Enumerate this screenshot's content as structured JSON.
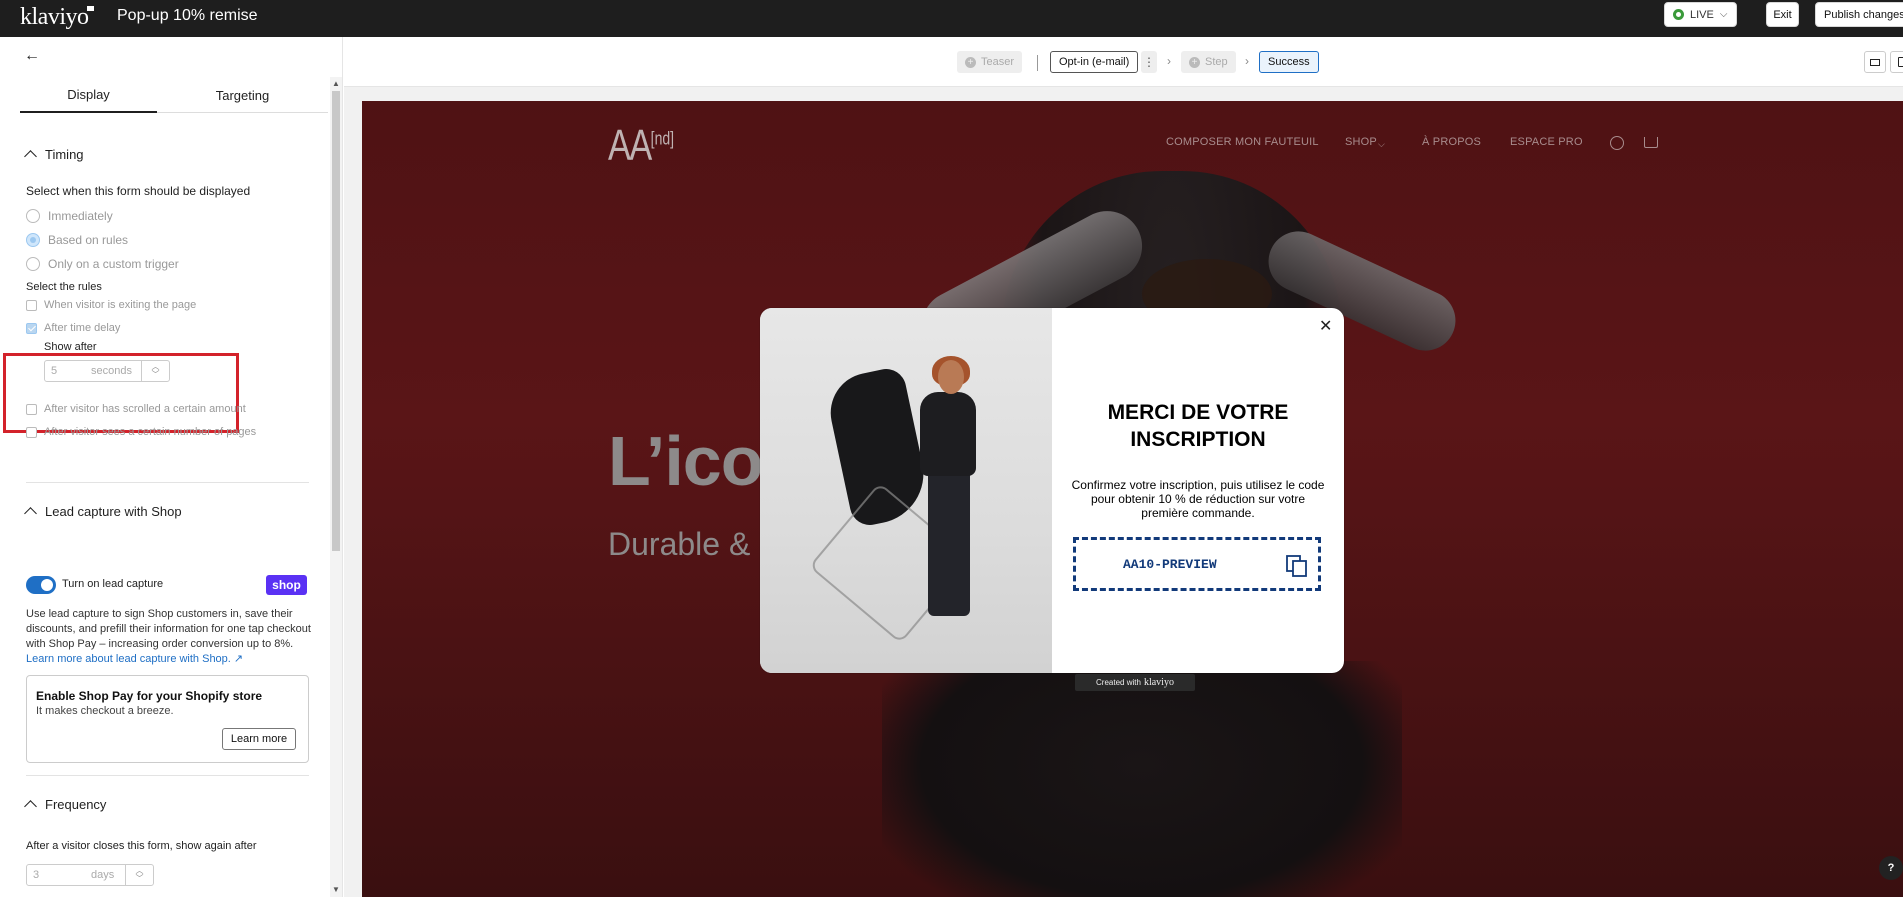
{
  "topbar": {
    "logo": "klaviyo",
    "form_title": "Pop-up 10% remise",
    "status_label": "LIVE",
    "exit_label": "Exit",
    "publish_label": "Publish changes"
  },
  "tabs": [
    {
      "label": "Display",
      "active": true
    },
    {
      "label": "Targeting",
      "active": false
    }
  ],
  "timing": {
    "heading": "Timing",
    "prompt": "Select when this form should be displayed",
    "options": [
      {
        "label": "Immediately",
        "selected": false
      },
      {
        "label": "Based on rules",
        "selected": true
      },
      {
        "label": "Only on a custom trigger",
        "selected": false
      }
    ],
    "rules_label": "Select the rules",
    "rules": [
      {
        "label": "When visitor is exiting the page",
        "checked": false
      },
      {
        "label": "After time delay",
        "checked": true
      },
      {
        "label": "After visitor has scrolled a certain amount",
        "checked": false
      },
      {
        "label": "After visitor sees a certain number of pages",
        "checked": false
      }
    ],
    "show_after_label": "Show after",
    "delay_value": "5",
    "delay_unit": "seconds"
  },
  "lead_capture": {
    "heading": "Lead capture with Shop",
    "toggle_label": "Turn on lead capture",
    "toggle_on": true,
    "badge": "shop",
    "description": "Use lead capture to sign Shop customers in, save their discounts, and prefill their information for one tap checkout with Shop Pay – increasing order conversion up to 8%.",
    "learn_link": "Learn more about lead capture with Shop.",
    "card_title": "Enable Shop Pay for your Shopify store",
    "card_subtitle": "It makes checkout a breeze.",
    "card_button": "Learn more"
  },
  "frequency": {
    "heading": "Frequency",
    "prompt": "After a visitor closes this form, show again after",
    "value": "3",
    "unit": "days"
  },
  "steps": {
    "teaser": "Teaser",
    "optin": "Opt-in (e-mail)",
    "step": "Step",
    "success": "Success"
  },
  "site": {
    "brand": "AA",
    "brand_sup": "[nd]",
    "nav": [
      "COMPOSER MON FAUTEUIL",
      "SHOP",
      "À PROPOS",
      "ESPACE PRO"
    ],
    "hero_title": "L’iconi",
    "hero_sub": "Durable & dési"
  },
  "popup": {
    "title": "MERCI DE VOTRE INSCRIPTION",
    "body": "Confirmez votre inscription, puis utilisez le code pour obtenir 10 % de réduction sur votre première commande.",
    "code": "AA10-PREVIEW",
    "created_with": "Created with",
    "created_brand": "klaviyo"
  },
  "colors": {
    "accent": "#1f6fc5",
    "highlight_box": "#d3222a",
    "shop_badge": "#5a31f4",
    "coupon_border": "#123a7a",
    "site_background": "#4f1214"
  },
  "help_label": "?"
}
